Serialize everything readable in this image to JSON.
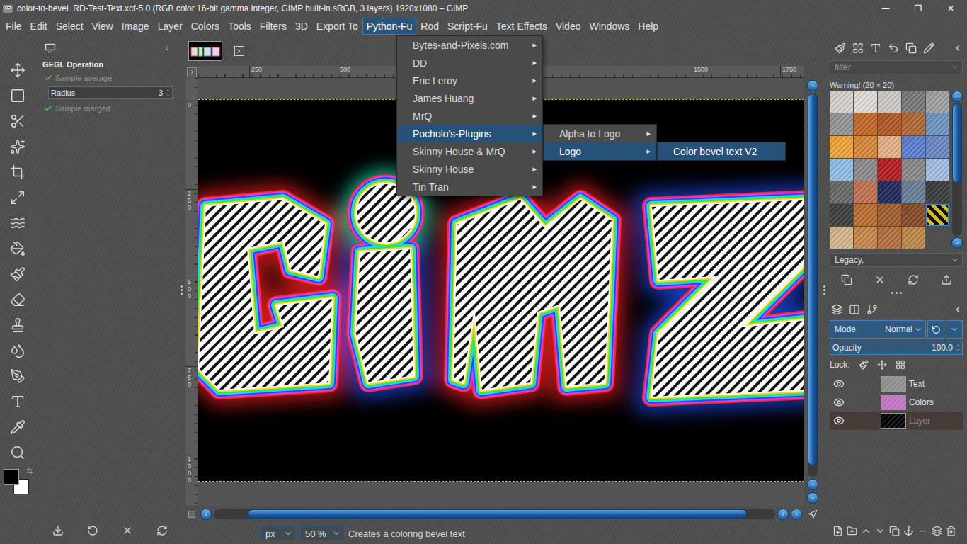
{
  "window": {
    "title": "color-to-bevel_RD-Test-Text.xcf-5.0 (RGB color 16-bit gamma integer, GIMP built-in sRGB, 3 layers) 1920x1080 – GIMP",
    "controls": [
      "—",
      "❐",
      "✕"
    ]
  },
  "menubar": [
    {
      "label": "File",
      "selected": false
    },
    {
      "label": "Edit",
      "selected": false
    },
    {
      "label": "Select",
      "selected": false
    },
    {
      "label": "View",
      "selected": false
    },
    {
      "label": "Image",
      "selected": false
    },
    {
      "label": "Layer",
      "selected": false
    },
    {
      "label": "Colors",
      "selected": false
    },
    {
      "label": "Tools",
      "selected": false
    },
    {
      "label": "Filters",
      "selected": false
    },
    {
      "label": "3D",
      "selected": false
    },
    {
      "label": "Export To",
      "selected": false
    },
    {
      "label": "Python-Fu",
      "selected": true
    },
    {
      "label": "Rod",
      "selected": false
    },
    {
      "label": "Script-Fu",
      "selected": false
    },
    {
      "label": "Text Effects",
      "selected": false
    },
    {
      "label": "Video",
      "selected": false
    },
    {
      "label": "Windows",
      "selected": false
    },
    {
      "label": "Help",
      "selected": false
    }
  ],
  "submenu_arrow": "▸",
  "menus": [
    {
      "items": [
        {
          "label": "Bytes-and-Pixels.com",
          "selected": false,
          "submenu": true
        },
        {
          "label": "DD",
          "selected": false,
          "submenu": true
        },
        {
          "label": "Eric Leroy",
          "selected": false,
          "submenu": true
        },
        {
          "label": "James Huang",
          "selected": false,
          "submenu": true
        },
        {
          "label": "MrQ",
          "selected": false,
          "submenu": true
        },
        {
          "label": "Pocholo's-Plugins",
          "selected": true,
          "submenu": true
        },
        {
          "label": "Skinny House & MrQ",
          "selected": false,
          "submenu": true
        },
        {
          "label": "Skinny House",
          "selected": false,
          "submenu": true
        },
        {
          "label": "Tin Tran",
          "selected": false,
          "submenu": true
        }
      ]
    },
    {
      "items": [
        {
          "label": "Alpha to Logo",
          "selected": false,
          "submenu": true
        },
        {
          "label": "Logo",
          "selected": true,
          "submenu": true
        }
      ]
    },
    {
      "items": [
        {
          "label": "Color bevel text V2",
          "selected": true,
          "submenu": false
        }
      ]
    }
  ],
  "tool_options": {
    "title": "GEGL Operation",
    "options": [
      {
        "kind": "checkbox",
        "label": "Sample average",
        "checked": true,
        "disabled": true
      },
      {
        "kind": "spin",
        "label": "Radius",
        "value": "3"
      },
      {
        "kind": "checkbox",
        "label": "Sample merged",
        "checked": true,
        "disabled": true
      }
    ]
  },
  "colors": {
    "foreground": "#000000",
    "background": "#ffffff"
  },
  "rulers": {
    "horizontal": [
      "250",
      "500",
      "1500",
      "1750"
    ],
    "vertical": [
      "0",
      "250",
      "500",
      "750",
      "1000"
    ]
  },
  "scrollbars": {
    "horizontal": {
      "offset": 0.06,
      "level": 0.89
    },
    "vertical": {
      "offset": 0,
      "level": 0.97
    },
    "patterns": {
      "offset": 0,
      "level": 0.6
    }
  },
  "status_bar": {
    "unit": "px",
    "zoom": "50 %",
    "message": "Creates a coloring bevel text"
  },
  "dock": {
    "filter_placeholder": "filter",
    "pattern_title": "Warning! (20 × 20)",
    "tag_field": "Legacy,",
    "patterns": [
      {
        "color": "#d9d6d0",
        "selected": false
      },
      {
        "color": "#e4e1dc",
        "selected": false
      },
      {
        "color": "#d2cec8",
        "selected": false
      },
      {
        "color": "#7a7a7a",
        "selected": false
      },
      {
        "color": "#a3a3a3",
        "selected": false
      },
      {
        "color": "#9a9896",
        "selected": false
      },
      {
        "color": "#c56b2c",
        "selected": false
      },
      {
        "color": "#b4592a",
        "selected": false
      },
      {
        "color": "#b36a38",
        "selected": false
      },
      {
        "color": "#6f98c4",
        "selected": false
      },
      {
        "color": "#f0a83a",
        "selected": false
      },
      {
        "color": "#da8b3c",
        "selected": false
      },
      {
        "color": "#e6b48a",
        "selected": false
      },
      {
        "color": "#5b82d2",
        "selected": false
      },
      {
        "color": "#6d8bc9",
        "selected": false
      },
      {
        "color": "#93c2ea",
        "selected": false
      },
      {
        "color": "#8d8d8d",
        "selected": false
      },
      {
        "color": "#b81e1e",
        "selected": false
      },
      {
        "color": "#8b8b8b",
        "selected": false
      },
      {
        "color": "#a6c2e6",
        "selected": false
      },
      {
        "color": "#6b6b6b",
        "selected": false
      },
      {
        "color": "#c47452",
        "selected": false
      },
      {
        "color": "#1f2d5c",
        "selected": false
      },
      {
        "color": "#6c8199",
        "selected": false
      },
      {
        "color": "#3c3c3c",
        "selected": false
      },
      {
        "color": "#3f3f3f",
        "selected": false
      },
      {
        "color": "#bb7232",
        "selected": false
      },
      {
        "color": "#a2612f",
        "selected": false
      },
      {
        "color": "#8b4b29",
        "selected": false
      },
      {
        "color": "#d4bd10",
        "selected": true
      },
      {
        "color": "#d9b98e",
        "selected": false
      },
      {
        "color": "#c98a52",
        "selected": false
      },
      {
        "color": "#b97242",
        "selected": false
      },
      {
        "color": "#c28a4a",
        "selected": false
      }
    ]
  },
  "layers": {
    "mode_label": "Mode",
    "mode": "Normal",
    "opacity_label": "Opacity",
    "opacity": "100.0",
    "opacity_level": 1,
    "lock_label": "Lock:",
    "items": [
      {
        "name": "Text",
        "visible": true,
        "selected": false,
        "thumb": "#8c8c8c"
      },
      {
        "name": "Colors",
        "visible": true,
        "selected": false,
        "thumb": "#c070c0"
      },
      {
        "name": "Layer",
        "visible": true,
        "selected": true,
        "thumb": "#000000"
      }
    ]
  }
}
